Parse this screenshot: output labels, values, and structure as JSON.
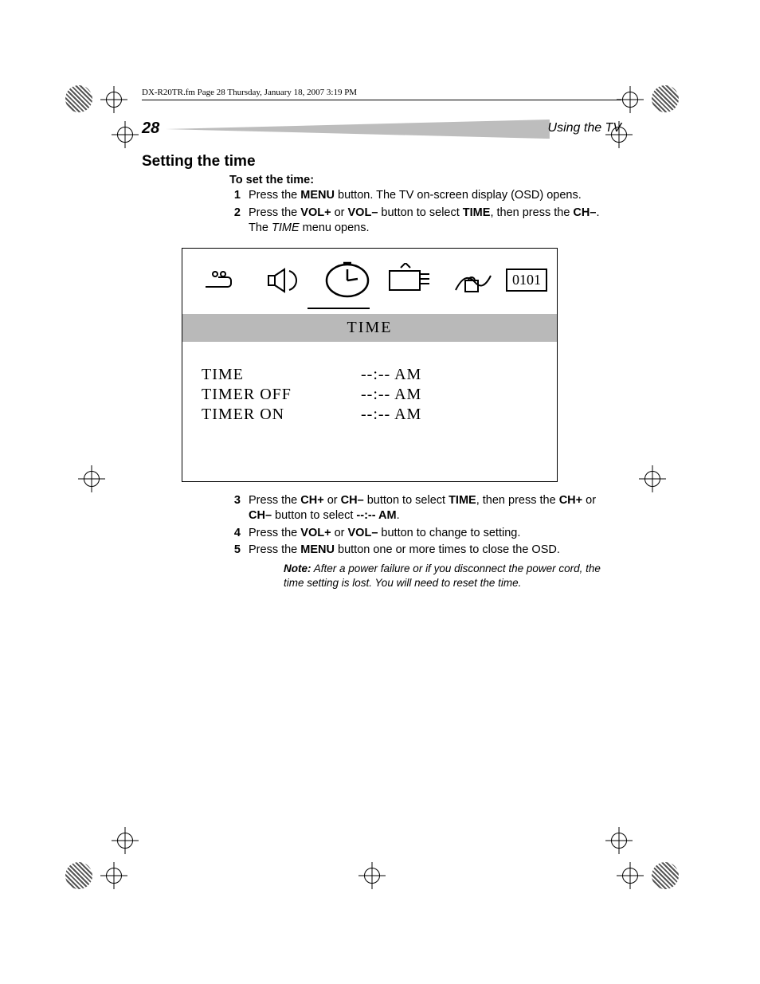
{
  "running_head": "DX-R20TR.fm  Page 28  Thursday, January 18, 2007  3:19 PM",
  "page_number": "28",
  "section_tag": "Using the TV",
  "section_title": "Setting the time",
  "intro": "To set the time:",
  "steps": {
    "s1": {
      "num": "1",
      "text_a": "Press the ",
      "b1": "MENU",
      "text_b": " button. The TV on-screen display (OSD) opens."
    },
    "s2": {
      "num": "2",
      "text_a": "Press the ",
      "b1": "VOL+",
      "text_b": " or ",
      "b2": "VOL–",
      "text_c": " button to select ",
      "b3": "TIME",
      "text_d": ", then press the ",
      "b4": "CH–",
      "text_e": ". The ",
      "i1": "TIME",
      "text_f": " menu opens."
    },
    "s3": {
      "num": "3",
      "text_a": "Press the ",
      "b1": "CH+",
      "text_b": " or ",
      "b2": "CH–",
      "text_c": " button to select ",
      "b3": "TIME",
      "text_d": ", then press the ",
      "b4": "CH+",
      "text_e": " or ",
      "b5": "CH–",
      "text_f": " button to select ",
      "b6": "--:-- AM",
      "text_g": "."
    },
    "s4": {
      "num": "4",
      "text_a": "Press the ",
      "b1": "VOL+",
      "text_b": " or ",
      "b2": "VOL–",
      "text_c": " button to change to setting."
    },
    "s5": {
      "num": "5",
      "text_a": "Press the ",
      "b1": "MENU",
      "text_b": " button one or more times to close the OSD."
    }
  },
  "note": {
    "label": "Note:",
    "text": " After a power failure or if you disconnect the power cord, the time setting is lost. You will need to reset the time."
  },
  "osd": {
    "tab_code": "0101",
    "title": "TIME",
    "rows": {
      "r1": {
        "label": "TIME",
        "value": "--:-- AM"
      },
      "r2": {
        "label": "TIMER OFF",
        "value": "--:-- AM"
      },
      "r3": {
        "label": "TIMER ON",
        "value": "--:-- AM"
      }
    }
  }
}
